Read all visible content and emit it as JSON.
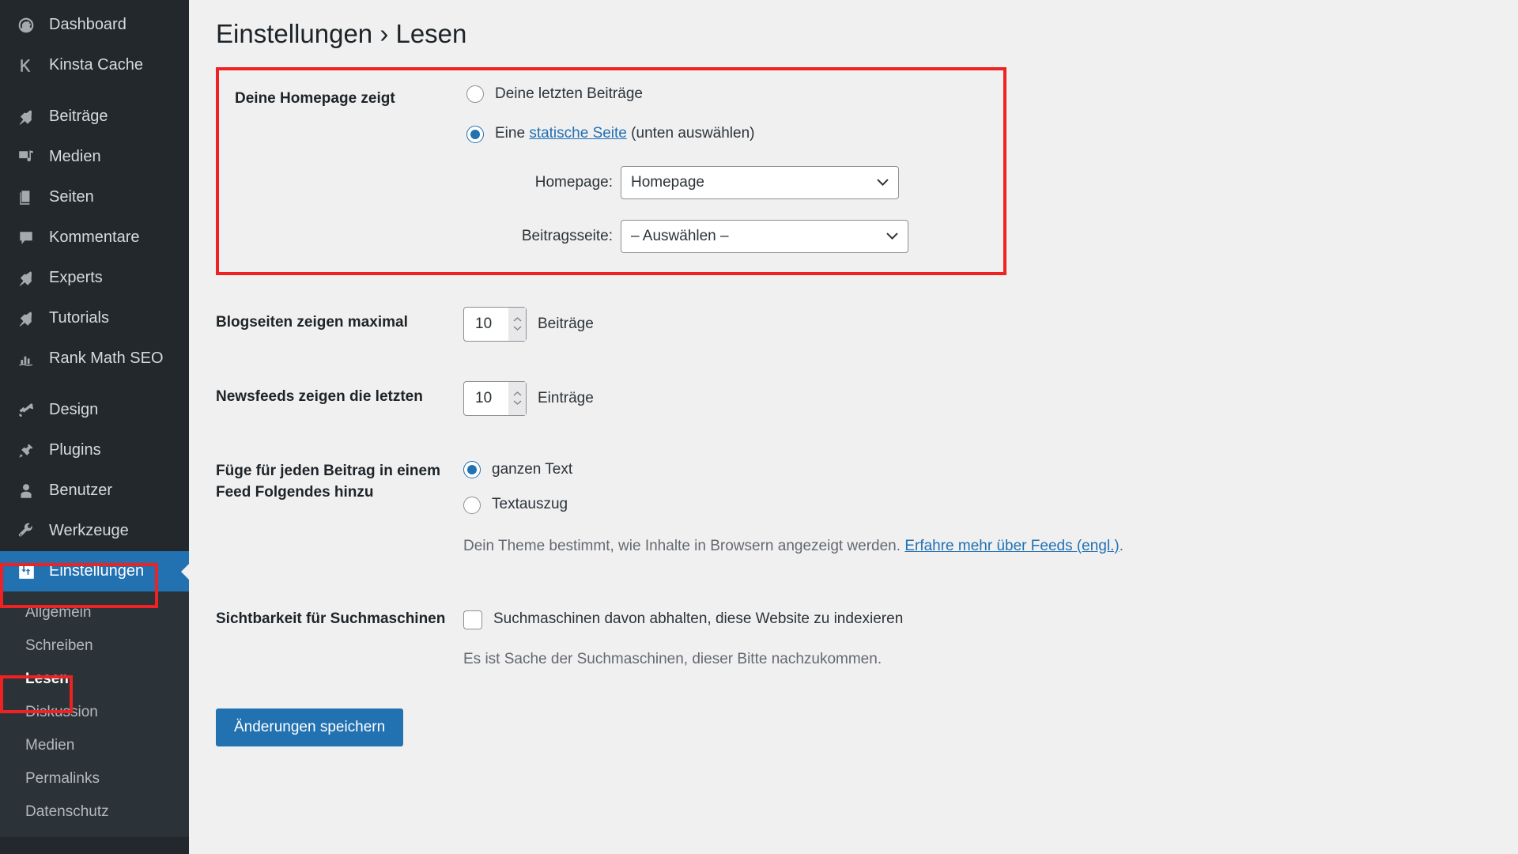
{
  "colors": {
    "sidebar_bg": "#23282d",
    "submenu_bg": "#2c3338",
    "accent_blue": "#2271b1",
    "annotation_red": "#ee2222",
    "page_bg": "#f0f0f1"
  },
  "sidebar": {
    "items": [
      {
        "label": "Dashboard",
        "icon": "dashboard-icon",
        "active": false
      },
      {
        "label": "Kinsta Cache",
        "icon": "kinsta-k-icon",
        "active": false
      },
      {
        "label": "Beiträge",
        "icon": "pin-icon",
        "active": false
      },
      {
        "label": "Medien",
        "icon": "media-icon",
        "active": false
      },
      {
        "label": "Seiten",
        "icon": "pages-icon",
        "active": false
      },
      {
        "label": "Kommentare",
        "icon": "comment-icon",
        "active": false
      },
      {
        "label": "Experts",
        "icon": "pin-icon",
        "active": false
      },
      {
        "label": "Tutorials",
        "icon": "pin-icon",
        "active": false
      },
      {
        "label": "Rank Math SEO",
        "icon": "chart-icon",
        "active": false
      },
      {
        "label": "Design",
        "icon": "paintbrush-icon",
        "active": false
      },
      {
        "label": "Plugins",
        "icon": "plug-icon",
        "active": false
      },
      {
        "label": "Benutzer",
        "icon": "user-icon",
        "active": false
      },
      {
        "label": "Werkzeuge",
        "icon": "wrench-icon",
        "active": false
      },
      {
        "label": "Einstellungen",
        "icon": "settings-sliders-icon",
        "active": true
      }
    ],
    "submenu": [
      {
        "label": "Allgemein",
        "current": false
      },
      {
        "label": "Schreiben",
        "current": false
      },
      {
        "label": "Lesen",
        "current": true
      },
      {
        "label": "Diskussion",
        "current": false
      },
      {
        "label": "Medien",
        "current": false
      },
      {
        "label": "Permalinks",
        "current": false
      },
      {
        "label": "Datenschutz",
        "current": false
      }
    ]
  },
  "page": {
    "title": "Einstellungen › Lesen"
  },
  "homepage_section": {
    "label": "Deine Homepage zeigt",
    "radio_latest_posts": "Deine letzten Beiträge",
    "radio_static_prefix": "Eine ",
    "radio_static_link": "statische Seite",
    "radio_static_suffix": " (unten auswählen)",
    "selected": "static_page",
    "homepage_select": {
      "label": "Homepage:",
      "value": "Homepage"
    },
    "posts_page_select": {
      "label": "Beitragsseite:",
      "value": "– Auswählen –"
    }
  },
  "blog_pages": {
    "label": "Blogseiten zeigen maximal",
    "value": "10",
    "unit": "Beiträge"
  },
  "newsfeeds": {
    "label": "Newsfeeds zeigen die letzten",
    "value": "10",
    "unit": "Einträge"
  },
  "feed_content": {
    "label": "Füge für jeden Beitrag in einem Feed Folgendes hinzu",
    "option_full": "ganzen Text",
    "option_excerpt": "Textauszug",
    "selected": "full",
    "description_text": "Dein Theme bestimmt, wie Inhalte in Browsern angezeigt werden. ",
    "description_link": "Erfahre mehr über Feeds (engl.)",
    "description_end": "."
  },
  "search_visibility": {
    "label": "Sichtbarkeit für Suchmaschinen",
    "checkbox_label": "Suchmaschinen davon abhalten, diese Website zu indexieren",
    "checked": false,
    "note": "Es ist Sache der Suchmaschinen, dieser Bitte nachzukommen."
  },
  "submit": {
    "label": "Änderungen speichern"
  }
}
